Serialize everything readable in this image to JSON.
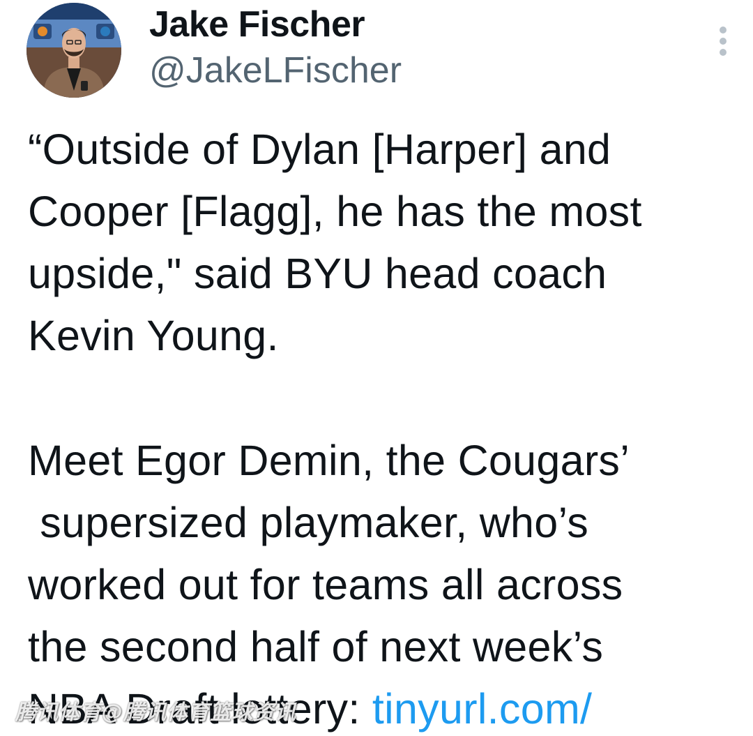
{
  "author": {
    "name": "Jake Fischer",
    "handle": "@JakeLFischer"
  },
  "tweet": {
    "lines": [
      "“Outside of Dylan [Harper] and",
      "Cooper [Flagg], he has the most",
      "upside,\" said BYU head coach",
      "Kevin Young.",
      "Meet Egor Demin, the Cougars’",
      " supersized playmaker, who’s",
      "worked out for teams all across",
      "the second half of next week’s",
      "NBA Draft lottery: "
    ],
    "link_text": "tinyurl.com/"
  },
  "watermark": "腾讯体育@腾讯体育篮球资讯",
  "icons": {
    "more": "more-vertical-icon"
  },
  "colors": {
    "text": "#0f1419",
    "secondary": "#536471",
    "link": "#1d9bf0"
  }
}
